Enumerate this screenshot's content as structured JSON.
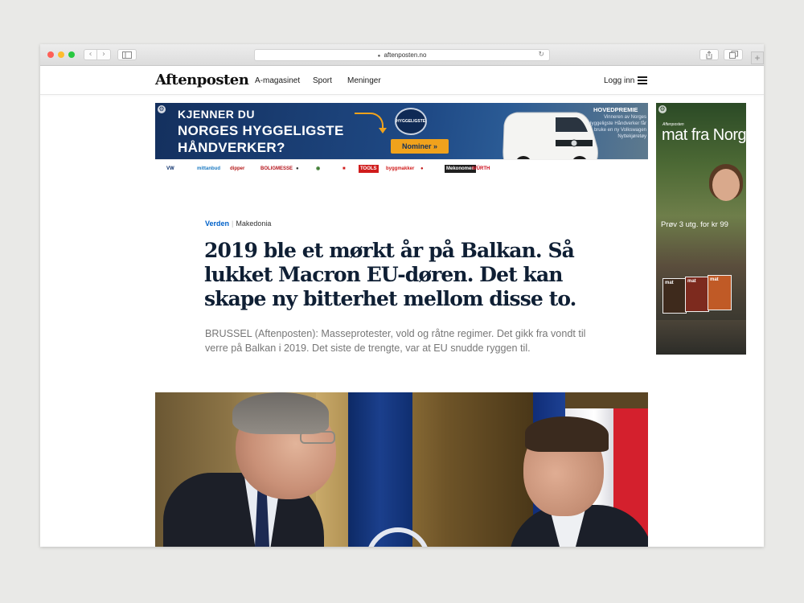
{
  "browser": {
    "url": "aftenposten.no",
    "back_glyph": "‹",
    "forward_glyph": "›",
    "newtab_glyph": "+"
  },
  "header": {
    "logo": "Aftenposten",
    "nav": [
      "A-magasinet",
      "Sport",
      "Meninger"
    ],
    "login": "Logg inn"
  },
  "banner_ad": {
    "line1": "KJENNER DU",
    "line2": "NORGES HYGGELIGSTE",
    "line3": "HÅNDVERKER?",
    "badge": "HYGGELIGSTE",
    "cta": "Nominer »",
    "prize_title": "HOVEDPREMIE",
    "prize_text": "Vinneren av Norges Hyggeligste Håndverker får bruke en ny Volkswagen Nyttekjøretøy",
    "sponsors": [
      "VW",
      "mittanbud",
      "dipper",
      "BOLIGMESSE",
      "●",
      "◉",
      "■",
      "TOOLS",
      "byggmakker",
      "●",
      "Mekonomen",
      "WÜRTH"
    ]
  },
  "side_ad": {
    "brand": "Aftenposten",
    "title": "mat fra Norge",
    "offer": "Prøv 3 utg. for kr 99",
    "mag_label": "mat"
  },
  "article": {
    "section": "Verden",
    "topic": "Makedonia",
    "headline": "2019 ble et mørkt år på Balkan. Så lukket Macron EU-døren. Det kan skape ny bitterhet mellom disse to.",
    "lead": "BRUSSEL (Aftenposten): Masseprotester, vold og råtne regimer. Det gikk fra vondt til verre på Balkan i 2019. Det siste de trengte, var at EU snudde ryggen til."
  },
  "colors": {
    "accent_link": "#0061c9",
    "headline": "#0f1f34",
    "ad_navy": "#14305e",
    "ad_orange": "#f0a21c"
  }
}
